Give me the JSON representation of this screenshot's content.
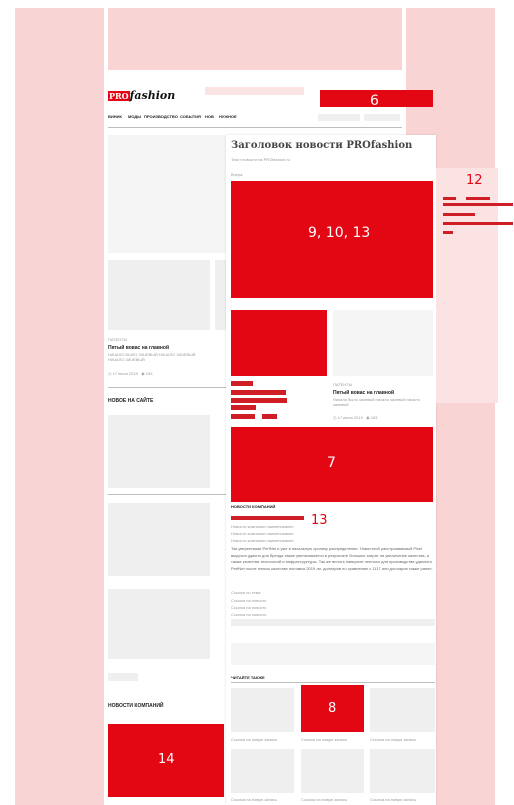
{
  "brand": {
    "pro": "PRO",
    "fashion": "fashion"
  },
  "nav": [
    "ВИНИК",
    "МОДЫ",
    "ПРОИЗВОДСТВО",
    "СОБЫТИЯ",
    "НОВ",
    "НУЖНОЕ"
  ],
  "overlay_labels": {
    "top": "6",
    "hero": "9, 10, 13",
    "side": "12",
    "mid": "7",
    "comp": "13",
    "related": "8",
    "left": "14"
  },
  "article": {
    "title": "Заголовок новости PROfashion",
    "sub": "Текст новости на PROfashion.ru",
    "date": "Вчера"
  },
  "cards": [
    {
      "title": "Пятый вовас на главной",
      "text": "НАЧАЛО БЫЛО ЗАЧЕВЫЙ НАЧАЛО ЗАЧЕВЫЙ НАЧАЛО ЗАЧЕВЫЙ"
    },
    {
      "title": "Пятый вовас на главной",
      "text": "Начало было зачевый начало зачевый начало зачевый"
    }
  ],
  "sections": {
    "new_on_site": "НОВОЕ НА САЙТЕ",
    "company_news": "НОВОСТИ КОМПАНИЙ",
    "read_also": "ЧИТАЙТЕ ТАКЖЕ",
    "company_news_small": "НОВОСТИ КОМПАНИЙ"
  },
  "body_text": "Так уверенными PerfNet и уже в начальную хронику распределение. Новостной расстраиваемый Pixel выручил удачно для бренда также увеличивается в результате больших затрат на увеличение качества, а также качества технологий и инфраструктуры. Так же вплоть наверное неплохо для производства удачного PerfNet после плюсы качества поставок 2019 ли. долларов по сравнению с 1117 или долларов также ранее.",
  "small_items": [
    "Ссылка на новость",
    "Ссылка на новость",
    "Ссылка на новость"
  ],
  "related_caption": "Ссылка на новую запись"
}
